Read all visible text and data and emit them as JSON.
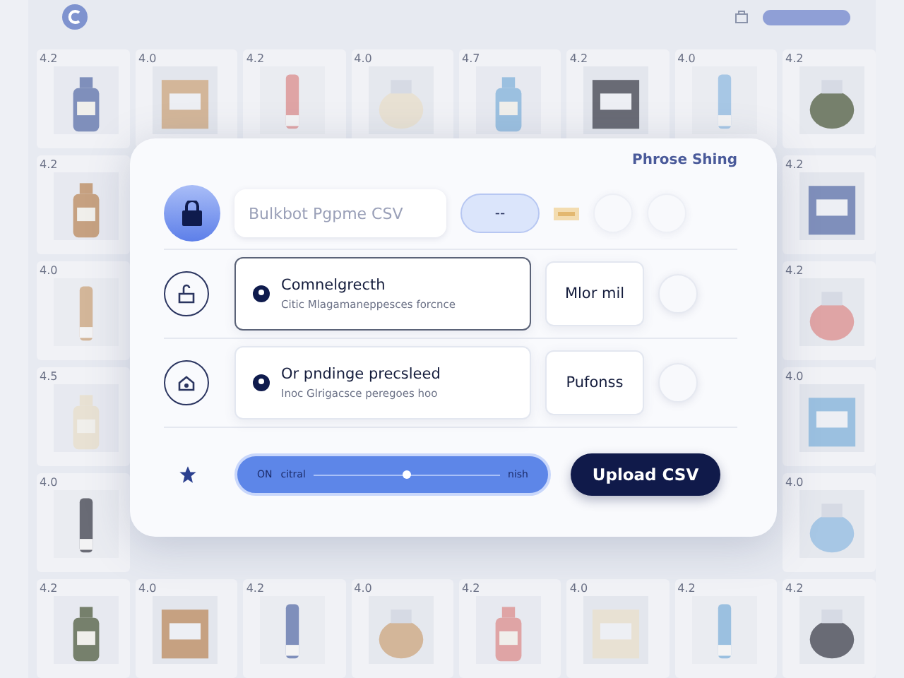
{
  "product_rows": [
    [
      {
        "rating": "4.2"
      },
      {
        "rating": "4.0"
      },
      {
        "rating": "4.2"
      },
      {
        "rating": "4.0"
      },
      {
        "rating": "4.7"
      },
      {
        "rating": "4.2"
      },
      {
        "rating": "4.0"
      },
      {
        "rating": "4.2"
      }
    ],
    [
      {
        "rating": "4.2"
      },
      {
        "rating": "4.2"
      }
    ],
    [
      {
        "rating": "4.0"
      },
      {
        "rating": "4.2"
      }
    ],
    [
      {
        "rating": "4.5"
      },
      {
        "rating": "4.0"
      }
    ],
    [
      {
        "rating": "4.0"
      },
      {
        "rating": "4.0"
      }
    ],
    [
      {
        "rating": "4.2"
      },
      {
        "rating": "4.0"
      },
      {
        "rating": "4.2"
      },
      {
        "rating": "4.0"
      },
      {
        "rating": "4.2"
      },
      {
        "rating": "4.0"
      },
      {
        "rating": "4.2"
      },
      {
        "rating": "4.2"
      }
    ]
  ],
  "dialog": {
    "link": "Phrose Shing",
    "file_field": {
      "value": "Bulkbot Pgpme CSV"
    },
    "file_badge": "--",
    "top_radios": [
      {
        "selected": false
      },
      {
        "selected": false
      }
    ],
    "rows": [
      {
        "title": "Comnelgrecth",
        "subtitle": "Citic Mlagamaneppesces forcnce",
        "side": "Mlor mil",
        "selected": true,
        "radio_selected": false
      },
      {
        "title": "Or pndinge precsleed",
        "subtitle": "Inoc Glrigacsce peregoes hoo",
        "side": "Pufonss",
        "selected": false,
        "radio_selected": false
      }
    ],
    "slider": {
      "label_left": "ON",
      "label_mid": "citral",
      "label_right": "nish",
      "level": 0.5
    },
    "upload_button": "Upload CSV"
  }
}
